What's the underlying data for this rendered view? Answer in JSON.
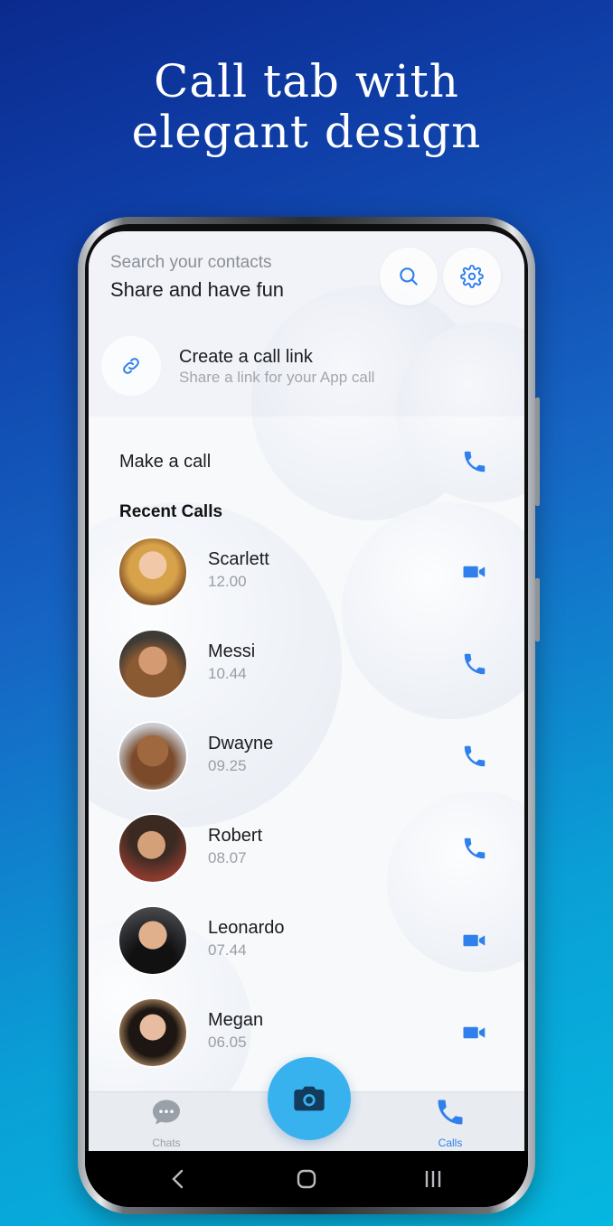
{
  "promo": {
    "line1": "Call tab with",
    "line2": "elegant design"
  },
  "header": {
    "search_hint": "Search your contacts",
    "subtitle": "Share and have fun",
    "search_icon": "search-icon",
    "settings_icon": "gear-icon"
  },
  "call_link": {
    "title": "Create a call link",
    "subtitle": "Share a link for your App call",
    "icon": "link-icon"
  },
  "make_call": {
    "label": "Make a call",
    "icon": "phone-icon"
  },
  "recent": {
    "heading": "Recent Calls",
    "calls": [
      {
        "name": "Scarlett",
        "time": "12.00",
        "type": "video"
      },
      {
        "name": "Messi",
        "time": "10.44",
        "type": "voice"
      },
      {
        "name": "Dwayne",
        "time": "09.25",
        "type": "voice"
      },
      {
        "name": "Robert",
        "time": "08.07",
        "type": "voice"
      },
      {
        "name": "Leonardo",
        "time": "07.44",
        "type": "video"
      },
      {
        "name": "Megan",
        "time": "06.05",
        "type": "video"
      }
    ]
  },
  "nav": {
    "chats": "Chats",
    "calls": "Calls",
    "fab_icon": "camera-icon"
  },
  "colors": {
    "accent": "#2f80ed",
    "fab": "#38b2ef",
    "inactive": "#9aa0a8"
  }
}
